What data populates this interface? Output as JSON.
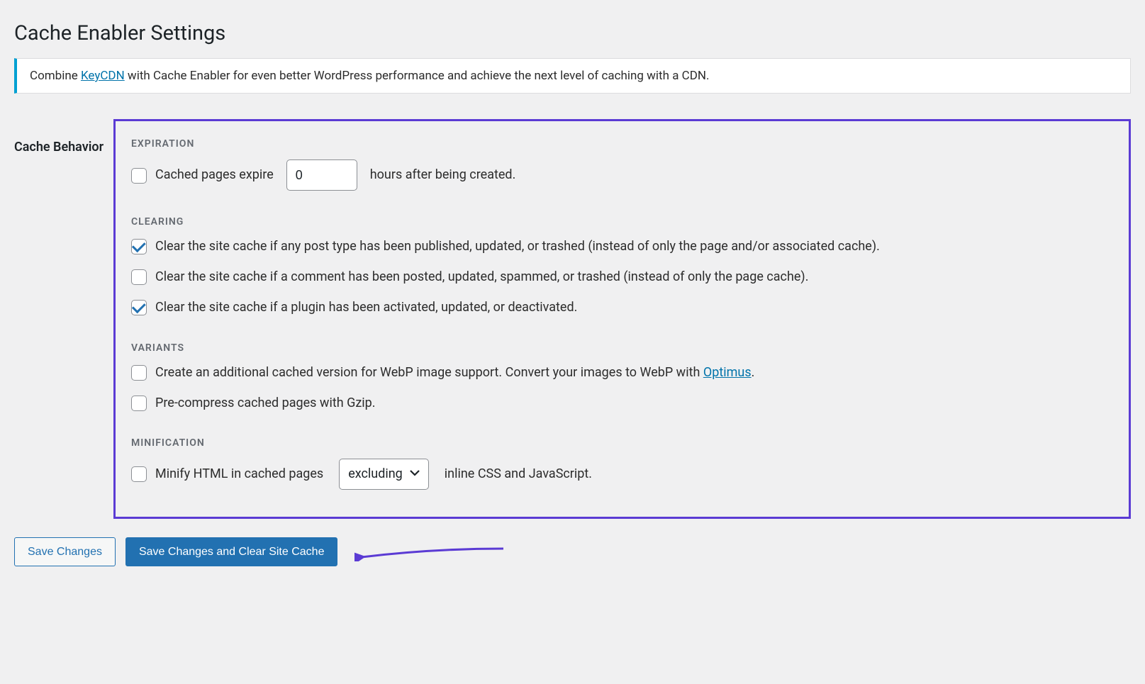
{
  "page": {
    "title": "Cache Enabler Settings"
  },
  "notice": {
    "pre": "Combine ",
    "link": "KeyCDN",
    "post": " with Cache Enabler for even better WordPress performance and achieve the next level of caching with a CDN."
  },
  "form": {
    "row_label": "Cache Behavior",
    "expiration": {
      "heading": "EXPIRATION",
      "pre": "Cached pages expire",
      "value": "0",
      "post": "hours after being created."
    },
    "clearing": {
      "heading": "CLEARING",
      "opt1": "Clear the site cache if any post type has been published, updated, or trashed (instead of only the page and/or associated cache).",
      "opt2": "Clear the site cache if a comment has been posted, updated, spammed, or trashed (instead of only the page cache).",
      "opt3": "Clear the site cache if a plugin has been activated, updated, or deactivated."
    },
    "variants": {
      "heading": "VARIANTS",
      "opt1_pre": "Create an additional cached version for WebP image support. Convert your images to WebP with ",
      "opt1_link": "Optimus",
      "opt1_post": ".",
      "opt2": "Pre-compress cached pages with Gzip."
    },
    "minification": {
      "heading": "MINIFICATION",
      "pre": "Minify HTML in cached pages",
      "select_value": "excluding",
      "post": "inline CSS and JavaScript."
    }
  },
  "buttons": {
    "save": "Save Changes",
    "save_clear": "Save Changes and Clear Site Cache"
  }
}
